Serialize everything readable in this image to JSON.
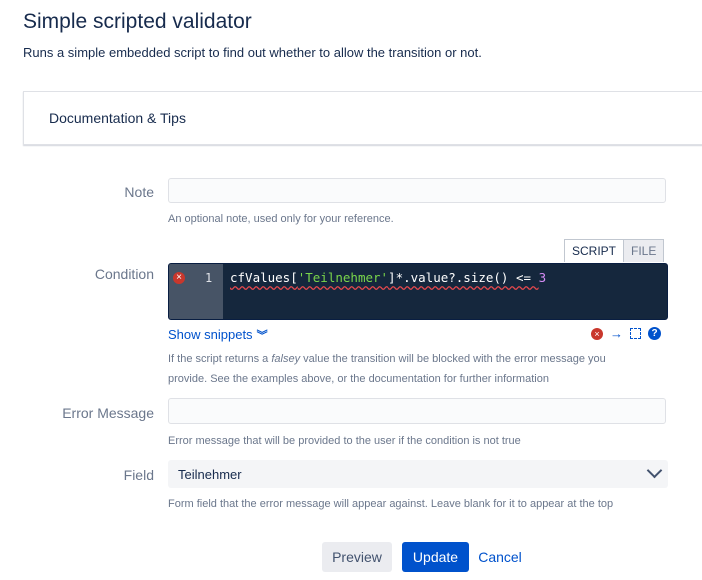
{
  "header": {
    "title": "Simple scripted validator",
    "subtitle": "Runs a simple embedded script to find out whether to allow the transition or not."
  },
  "documentation": {
    "label": "Documentation & Tips"
  },
  "note": {
    "label": "Note",
    "value": "",
    "help": "An optional note, used only for your reference."
  },
  "condition": {
    "label": "Condition",
    "tabs": [
      {
        "label": "SCRIPT"
      },
      {
        "label": "FILE"
      }
    ],
    "line_number": "1",
    "code": {
      "part1": "cfValues[",
      "string": "'Teilnehmer'",
      "part2": "]*.value?.size() <= ",
      "number": "3"
    },
    "show_snippets": "Show snippets",
    "help_part1": "If the script returns a ",
    "help_em": "falsey",
    "help_part2": " value the transition will be blocked with the error message you",
    "help_line2": "provide. See the examples above, or the documentation for further information"
  },
  "error_message": {
    "label": "Error Message",
    "value": "",
    "help": "Error message that will be provided to the user if the condition is not true"
  },
  "field": {
    "label": "Field",
    "selected": "Teilnehmer",
    "help": "Form field that the error message will appear against. Leave blank for it to appear at the top"
  },
  "buttons": {
    "preview": "Preview",
    "update": "Update",
    "cancel": "Cancel"
  },
  "colors": {
    "primary": "#0052cc",
    "editor_bg": "#15273d",
    "error": "#c9372c"
  }
}
